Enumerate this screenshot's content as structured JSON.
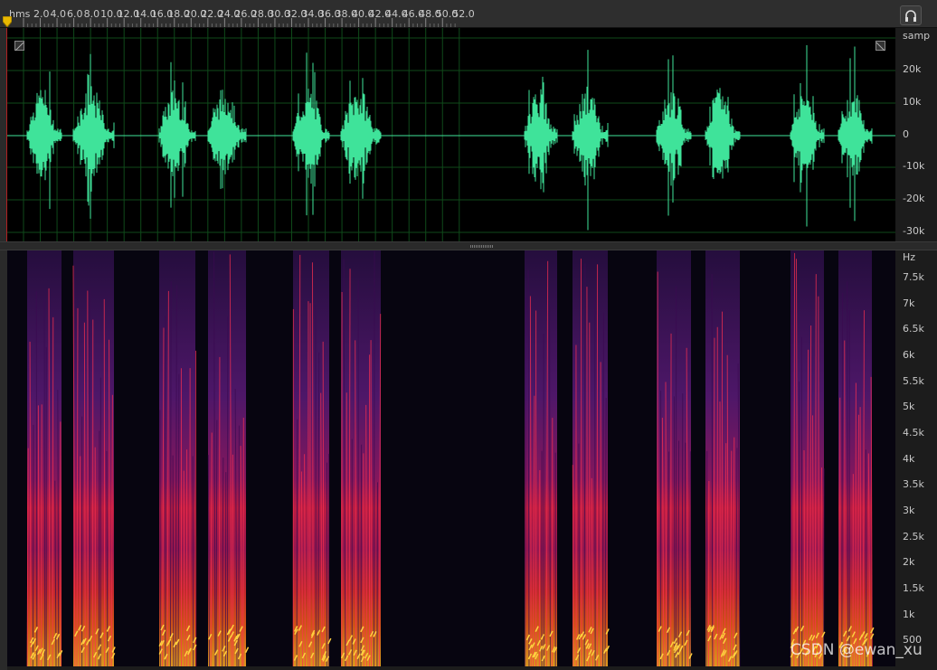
{
  "ruler": {
    "unit_label": "hms",
    "ticks": [
      "2.0",
      "4.0",
      "6.0",
      "8.0",
      "10.0",
      "12.0",
      "14.0",
      "16.0",
      "18.0",
      "20.0",
      "22.0",
      "24.0",
      "26.0",
      "28.0",
      "30.0",
      "32.0",
      "34.0",
      "36.0",
      "38.0",
      "40.0",
      "42.0",
      "44.0",
      "46.0",
      "48.0",
      "50.0",
      "52.0"
    ],
    "headphone_icon": "headphone-icon"
  },
  "waveform": {
    "axis_unit": "samp",
    "axis_labels": [
      "20k",
      "10k",
      "0",
      "-10k",
      "-20k",
      "-30k"
    ],
    "color": "#3fe39a"
  },
  "spectrogram": {
    "axis_unit": "Hz",
    "axis_labels": [
      "7.5k",
      "7k",
      "6.5k",
      "6k",
      "5.5k",
      "5k",
      "4.5k",
      "4k",
      "3.5k",
      "3k",
      "2.5k",
      "2k",
      "1.5k",
      "1k",
      "500"
    ]
  },
  "watermark": "CSDN @ewan_xu"
}
